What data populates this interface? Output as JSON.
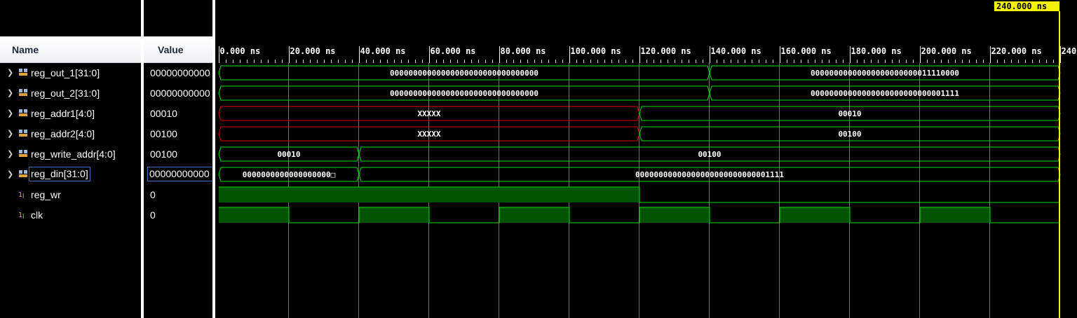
{
  "columns": {
    "name": "Name",
    "value": "Value"
  },
  "cursor": {
    "label": "240.000 ns",
    "time_ns": 240
  },
  "time_axis": {
    "unit": "ns",
    "tick_labels": [
      "0.000 ns",
      "20.000 ns",
      "40.000 ns",
      "60.000 ns",
      "80.000 ns",
      "100.000 ns",
      "120.000 ns",
      "140.000 ns",
      "160.000 ns",
      "180.000 ns",
      "200.000 ns",
      "220.000 ns",
      "240"
    ],
    "major_ticks_ns": [
      0,
      20,
      40,
      60,
      80,
      100,
      120,
      140,
      160,
      180,
      200,
      220,
      240
    ]
  },
  "signals": [
    {
      "name": "reg_out_1[31:0]",
      "value": "00000000000",
      "type": "bus",
      "expandable": true,
      "segments": [
        {
          "t0": 0,
          "t1": 140,
          "text": "00000000000000000000000000000000",
          "state": "valid"
        },
        {
          "t0": 140,
          "t1": 240,
          "text": "00000000000000000000000011110000",
          "state": "valid"
        }
      ]
    },
    {
      "name": "reg_out_2[31:0]",
      "value": "00000000000",
      "type": "bus",
      "expandable": true,
      "segments": [
        {
          "t0": 0,
          "t1": 140,
          "text": "00000000000000000000000000000000",
          "state": "valid"
        },
        {
          "t0": 140,
          "t1": 240,
          "text": "00000000000000000000000000001111",
          "state": "valid"
        }
      ]
    },
    {
      "name": "reg_addr1[4:0]",
      "value": "00010",
      "type": "bus",
      "expandable": true,
      "segments": [
        {
          "t0": 0,
          "t1": 120,
          "text": "XXXXX",
          "state": "unknown"
        },
        {
          "t0": 120,
          "t1": 240,
          "text": "00010",
          "state": "valid"
        }
      ]
    },
    {
      "name": "reg_addr2[4:0]",
      "value": "00100",
      "type": "bus",
      "expandable": true,
      "segments": [
        {
          "t0": 0,
          "t1": 120,
          "text": "XXXXX",
          "state": "unknown"
        },
        {
          "t0": 120,
          "t1": 240,
          "text": "00100",
          "state": "valid"
        }
      ]
    },
    {
      "name": "reg_write_addr[4:0]",
      "value": "00100",
      "type": "bus",
      "expandable": true,
      "segments": [
        {
          "t0": 0,
          "t1": 40,
          "text": "00010",
          "state": "valid"
        },
        {
          "t0": 40,
          "t1": 240,
          "text": "00100",
          "state": "valid"
        }
      ]
    },
    {
      "name": "reg_din[31:0]",
      "value": "00000000000",
      "type": "bus",
      "expandable": true,
      "selected": true,
      "segments": [
        {
          "t0": 0,
          "t1": 40,
          "text": "0000000000000000000□",
          "state": "valid"
        },
        {
          "t0": 40,
          "t1": 240,
          "text": "00000000000000000000000000001111",
          "state": "valid"
        }
      ]
    },
    {
      "name": "reg_wr",
      "value": "0",
      "type": "bit",
      "expandable": false,
      "levels": [
        {
          "t0": 0,
          "t1": 120,
          "v": 1
        },
        {
          "t0": 120,
          "t1": 240,
          "v": 0
        }
      ]
    },
    {
      "name": "clk",
      "value": "0",
      "type": "bit",
      "expandable": false,
      "levels": [
        {
          "t0": 0,
          "t1": 20,
          "v": 1
        },
        {
          "t0": 20,
          "t1": 40,
          "v": 0
        },
        {
          "t0": 40,
          "t1": 60,
          "v": 1
        },
        {
          "t0": 60,
          "t1": 80,
          "v": 0
        },
        {
          "t0": 80,
          "t1": 100,
          "v": 1
        },
        {
          "t0": 100,
          "t1": 120,
          "v": 0
        },
        {
          "t0": 120,
          "t1": 140,
          "v": 1
        },
        {
          "t0": 140,
          "t1": 160,
          "v": 0
        },
        {
          "t0": 160,
          "t1": 180,
          "v": 1
        },
        {
          "t0": 180,
          "t1": 200,
          "v": 0
        },
        {
          "t0": 200,
          "t1": 220,
          "v": 1
        },
        {
          "t0": 220,
          "t1": 240,
          "v": 0
        }
      ]
    }
  ],
  "colors": {
    "background": "#000000",
    "wave": "#00e000",
    "wave_fill": "#005400",
    "unknown": "#e00000",
    "cursor": "#f3f300",
    "grid": "#ffffff",
    "text": "#ffffff"
  }
}
